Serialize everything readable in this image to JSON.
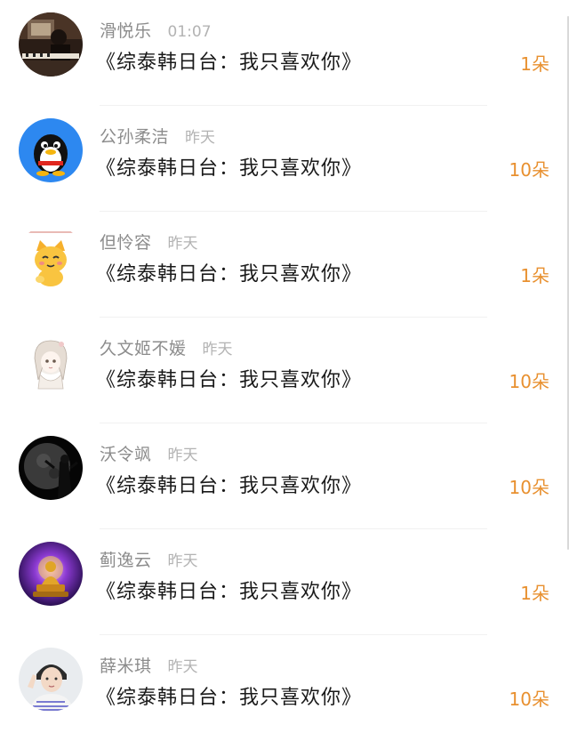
{
  "gifts": [
    {
      "name": "滑悦乐",
      "time": "01:07",
      "title": "《综泰韩日台：我只喜欢你》",
      "amount": "1朵",
      "avatar_icon": "piano-photo-icon"
    },
    {
      "name": "公孙柔洁",
      "time": "昨天",
      "title": "《综泰韩日台：我只喜欢你》",
      "amount": "10朵",
      "avatar_icon": "qq-penguin-icon"
    },
    {
      "name": "但怜容",
      "time": "昨天",
      "title": "《综泰韩日台：我只喜欢你》",
      "amount": "1朵",
      "avatar_icon": "cartoon-cat-icon"
    },
    {
      "name": "久文姬不媛",
      "time": "昨天",
      "title": "《综泰韩日台：我只喜欢你》",
      "amount": "10朵",
      "avatar_icon": "anime-girl-icon"
    },
    {
      "name": "沃令飒",
      "time": "昨天",
      "title": "《综泰韩日台：我只喜欢你》",
      "amount": "10朵",
      "avatar_icon": "dark-moon-icon"
    },
    {
      "name": "蓟逸云",
      "time": "昨天",
      "title": "《综泰韩日台：我只喜欢你》",
      "amount": "1朵",
      "avatar_icon": "buddha-icon"
    },
    {
      "name": "薛米琪",
      "time": "昨天",
      "title": "《综泰韩日台：我只喜欢你》",
      "amount": "10朵",
      "avatar_icon": "person-photo-icon"
    }
  ],
  "colors": {
    "amount": "#e8902f",
    "name": "#8c8c8c",
    "time": "#b3b3b3",
    "title": "#1a1a1a"
  }
}
